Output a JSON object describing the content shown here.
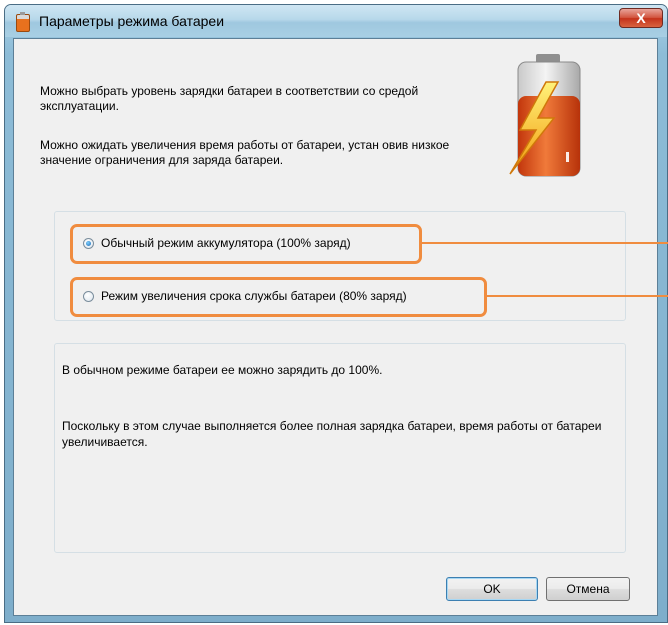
{
  "window": {
    "title": "Параметры режима батареи",
    "close_label": "X"
  },
  "description": {
    "line1": "Можно выбрать уровень зарядки батареи в соответствии со средой эксплуатации.",
    "line2": "Можно ожидать увеличения время работы от батареи, устан овив низкое значение ограничения для заряда батареи."
  },
  "modes": [
    {
      "label": "Обычный режим аккумулятора (100% заряд)",
      "selected": true
    },
    {
      "label": "Режим увеличения срока службы батареи (80% заряд)",
      "selected": false
    }
  ],
  "info": {
    "line1": "В обычном режиме батареи ее можно зарядить до 100%.",
    "line2": "Поскольку в этом случае выполняется более полная зарядка батареи, время работы от батареи увеличивается."
  },
  "buttons": {
    "ok": "OK",
    "cancel": "Отмена"
  },
  "colors": {
    "highlight": "#f08c3f",
    "window_frame": "#8dbcd7",
    "battery_fill": "#e0501a"
  }
}
